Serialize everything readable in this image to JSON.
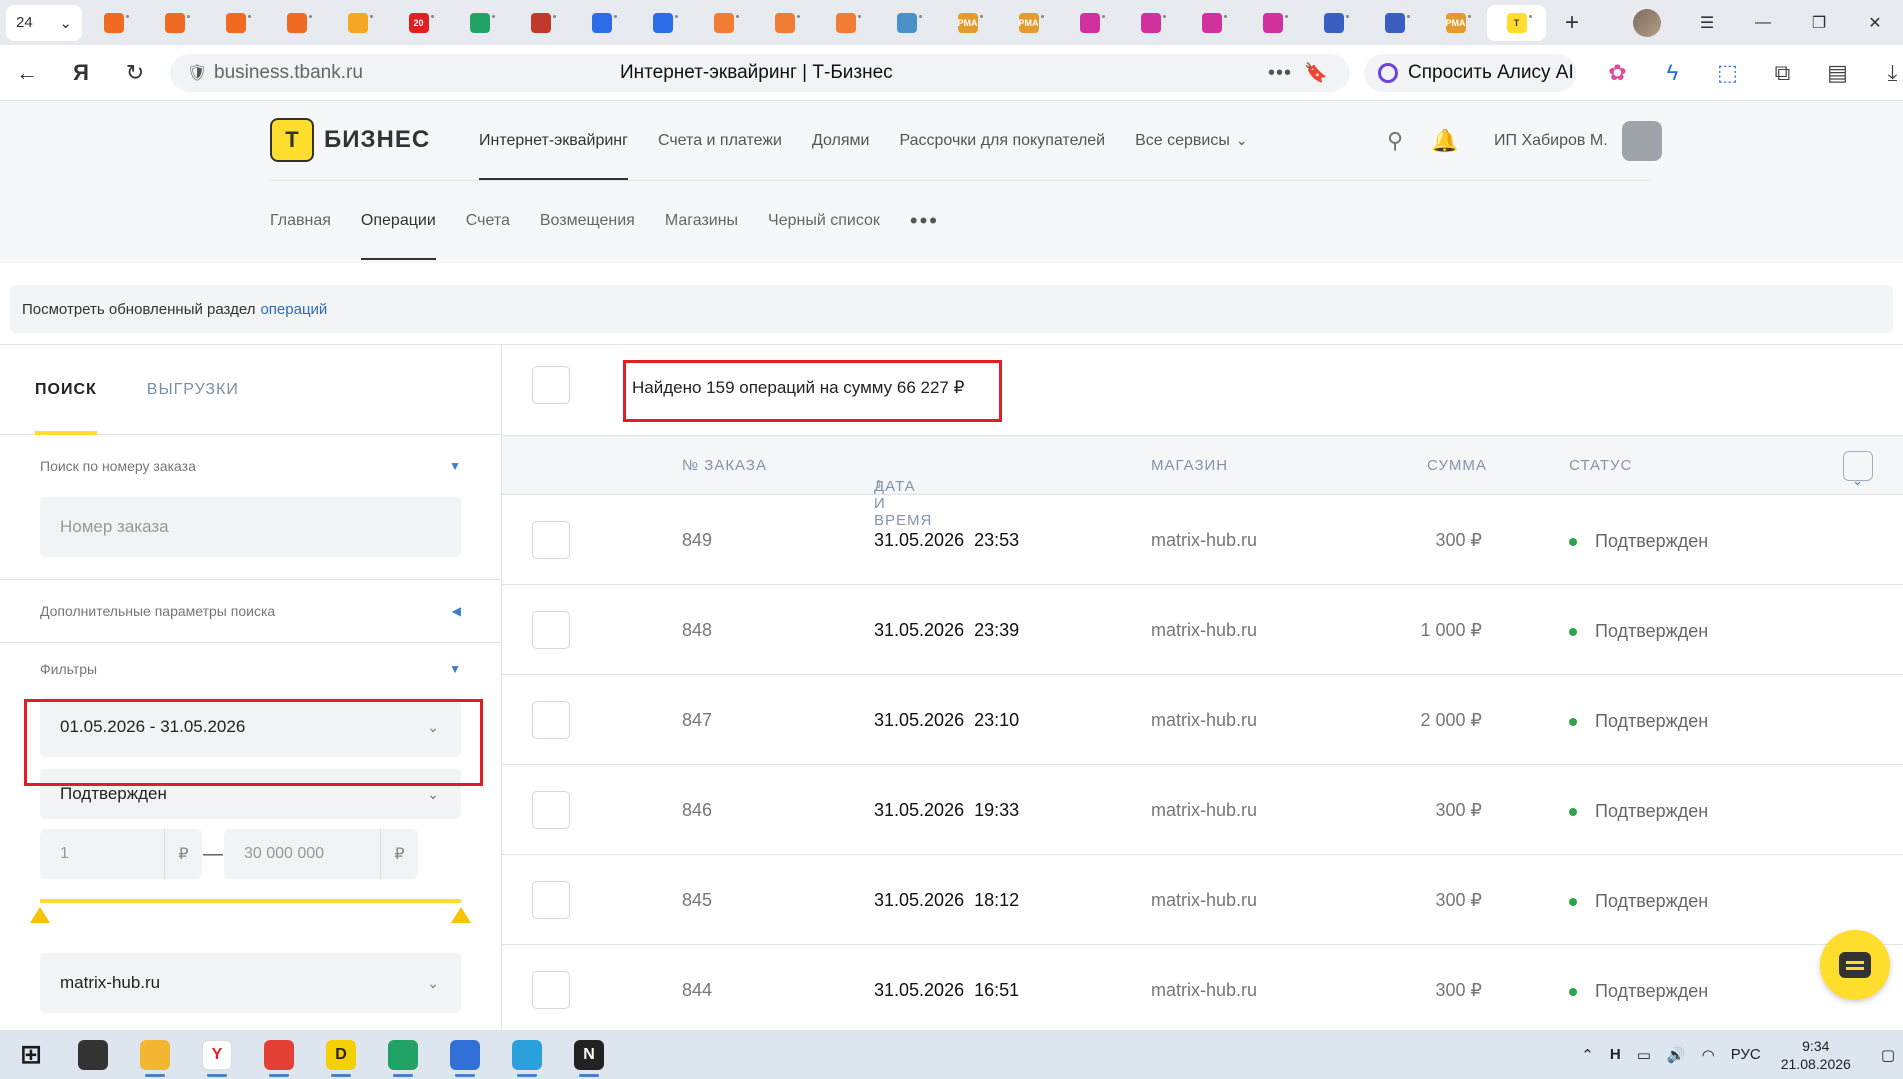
{
  "browser": {
    "tab_count": "24",
    "pinned_tabs": [
      {
        "name": "tab-flame-1",
        "color": "#f06a22"
      },
      {
        "name": "tab-flame-2",
        "color": "#f06a22"
      },
      {
        "name": "tab-flame-3",
        "color": "#f06a22"
      },
      {
        "name": "tab-flame-4",
        "color": "#f06a22"
      },
      {
        "name": "tab-mail",
        "color": "#f5a623"
      },
      {
        "name": "tab-calendar",
        "color": "#e02020",
        "label": "20"
      },
      {
        "name": "tab-sheets",
        "color": "#21a366"
      },
      {
        "name": "tab-presentation",
        "color": "#c0392b"
      },
      {
        "name": "tab-blue-1",
        "color": "#2b6de8"
      },
      {
        "name": "tab-blue-2",
        "color": "#2b6de8"
      },
      {
        "name": "tab-doc-1",
        "color": "#f07d33"
      },
      {
        "name": "tab-doc-2",
        "color": "#f07d33"
      },
      {
        "name": "tab-doc-3",
        "color": "#f07d33"
      },
      {
        "name": "tab-cloud",
        "color": "#4a90c9"
      },
      {
        "name": "tab-pma-1",
        "color": "#e59b2b",
        "label": "PMA"
      },
      {
        "name": "tab-pma-2",
        "color": "#e59b2b",
        "label": "PMA"
      },
      {
        "name": "tab-t-1",
        "color": "#d0319c"
      },
      {
        "name": "tab-t-2",
        "color": "#d0319c"
      },
      {
        "name": "tab-t-3",
        "color": "#d0319c"
      },
      {
        "name": "tab-t-4",
        "color": "#d0319c"
      },
      {
        "name": "tab-form",
        "color": "#3b5fc0"
      },
      {
        "name": "tab-chart",
        "color": "#3b5fc0"
      },
      {
        "name": "tab-pma-3",
        "color": "#e59b2b",
        "label": "PMA"
      },
      {
        "name": "tab-tbank-active",
        "color": "#ffdd2d",
        "label": "T"
      }
    ],
    "url_host": "business.tbank.ru",
    "page_title": "Интернет-эквайринг | Т-Бизнес",
    "alice_label": "Спросить Алису AI"
  },
  "header": {
    "brand": "БИЗНЕС",
    "logo_letter": "T",
    "top_nav": [
      "Интернет-эквайринг",
      "Счета и платежи",
      "Долями",
      "Рассрочки для покупателей",
      "Все сервисы"
    ],
    "user_name": "ИП Хабиров М.",
    "sub_nav": [
      "Главная",
      "Операции",
      "Счета",
      "Возмещения",
      "Магазины",
      "Черный список"
    ],
    "more": "•••"
  },
  "notice": {
    "text": "Посмотреть обновленный раздел",
    "link": "операций"
  },
  "left": {
    "tabs": [
      "ПОИСК",
      "ВЫГРУЗКИ"
    ],
    "order_search_title": "Поиск по номеру заказа",
    "order_placeholder": "Номер заказа",
    "extra_params_title": "Дополнительные параметры поиска",
    "filters_title": "Фильтры",
    "date_range": "01.05.2026 - 31.05.2026",
    "status_filter": "Подтвержден",
    "amount_from": "1",
    "amount_to": "30 000 000",
    "currency": "₽",
    "shop_filter": "matrix-hub.ru"
  },
  "main": {
    "summary": "Найдено 159 операций на сумму 66 227 ₽",
    "columns": {
      "order": "№ ЗАКАЗА",
      "date": "ДАТА И ВРЕМЯ",
      "shop": "МАГАЗИН",
      "sum": "СУММА",
      "status": "СТАТУС"
    },
    "rows": [
      {
        "order": "849",
        "date": "31.05.2026",
        "time": "23:53",
        "shop": "matrix-hub.ru",
        "sum": "300 ₽",
        "status": "Подтвержден"
      },
      {
        "order": "848",
        "date": "31.05.2026",
        "time": "23:39",
        "shop": "matrix-hub.ru",
        "sum": "1 000 ₽",
        "status": "Подтвержден"
      },
      {
        "order": "847",
        "date": "31.05.2026",
        "time": "23:10",
        "shop": "matrix-hub.ru",
        "sum": "2 000 ₽",
        "status": "Подтвержден"
      },
      {
        "order": "846",
        "date": "31.05.2026",
        "time": "19:33",
        "shop": "matrix-hub.ru",
        "sum": "300 ₽",
        "status": "Подтвержден"
      },
      {
        "order": "845",
        "date": "31.05.2026",
        "time": "18:12",
        "shop": "matrix-hub.ru",
        "sum": "300 ₽",
        "status": "Подтвержден"
      },
      {
        "order": "844",
        "date": "31.05.2026",
        "time": "16:51",
        "shop": "matrix-hub.ru",
        "sum": "300 ₽",
        "status": "Подтвержден"
      }
    ]
  },
  "taskbar": {
    "apps": [
      {
        "name": "start-button",
        "icon": "windows-icon",
        "color": "#1a1a1a"
      },
      {
        "name": "taskbar-chat",
        "icon": "chat-icon",
        "color": "#333333"
      },
      {
        "name": "taskbar-explorer",
        "icon": "folder-icon",
        "color": "#f2b632"
      },
      {
        "name": "taskbar-yandex-browser",
        "icon": "yandex-icon",
        "color": "#ffffff",
        "label": "Y"
      },
      {
        "name": "taskbar-chrome",
        "icon": "chrome-icon",
        "color": "#e34133"
      },
      {
        "name": "taskbar-app-d",
        "icon": "d-icon",
        "color": "#f5d000",
        "label": "D"
      },
      {
        "name": "taskbar-sheets",
        "icon": "sheets-icon",
        "color": "#21a366"
      },
      {
        "name": "taskbar-docs",
        "icon": "docs-icon",
        "color": "#2f6fd6"
      },
      {
        "name": "taskbar-telegram",
        "icon": "telegram-icon",
        "color": "#2aa1da"
      },
      {
        "name": "taskbar-notion",
        "icon": "n-icon",
        "color": "#222222",
        "label": "N"
      }
    ],
    "lang": "РУС",
    "time": "9:34",
    "date": "21.08.2026"
  }
}
